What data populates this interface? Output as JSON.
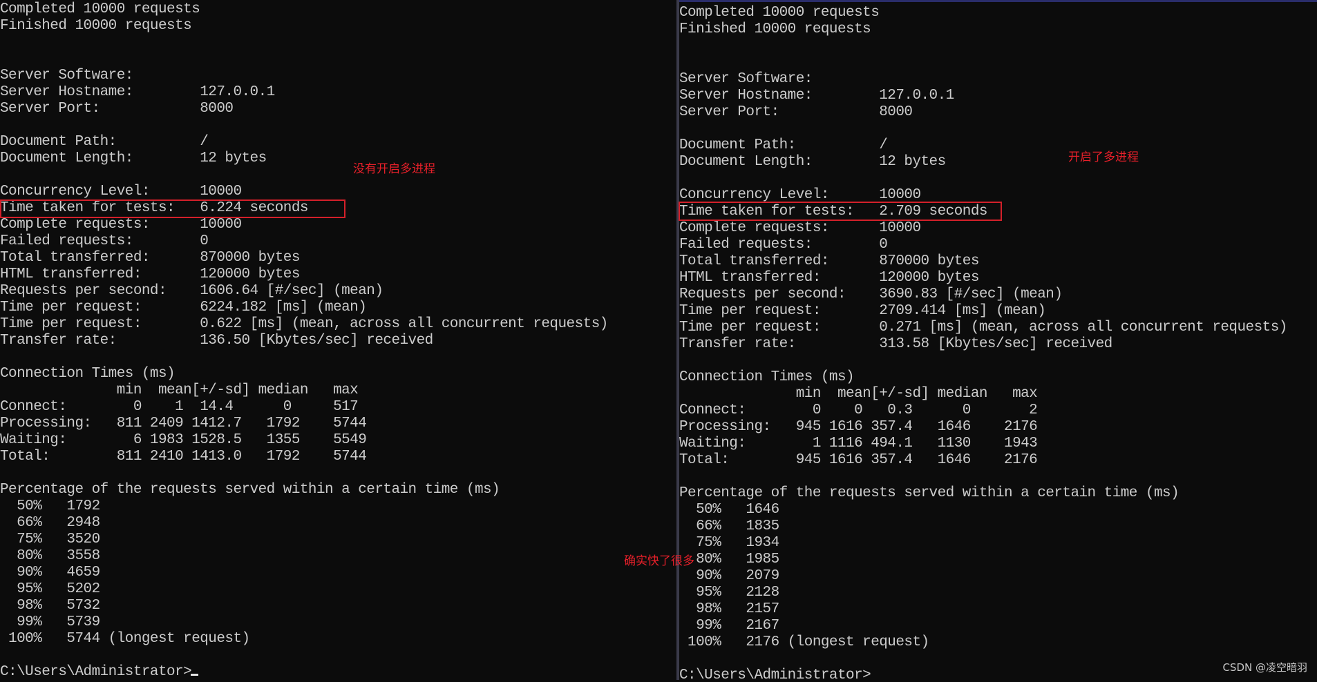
{
  "left": {
    "lines": [
      "Completed 10000 requests",
      "Finished 10000 requests",
      "",
      "",
      "Server Software:",
      "Server Hostname:        127.0.0.1",
      "Server Port:            8000",
      "",
      "Document Path:          /",
      "Document Length:        12 bytes",
      "",
      "Concurrency Level:      10000",
      "Time taken for tests:   6.224 seconds",
      "Complete requests:      10000",
      "Failed requests:        0",
      "Total transferred:      870000 bytes",
      "HTML transferred:       120000 bytes",
      "Requests per second:    1606.64 [#/sec] (mean)",
      "Time per request:       6224.182 [ms] (mean)",
      "Time per request:       0.622 [ms] (mean, across all concurrent requests)",
      "Transfer rate:          136.50 [Kbytes/sec] received",
      "",
      "Connection Times (ms)",
      "              min  mean[+/-sd] median   max",
      "Connect:        0    1  14.4      0     517",
      "Processing:   811 2409 1412.7   1792    5744",
      "Waiting:        6 1983 1528.5   1355    5549",
      "Total:        811 2410 1413.0   1792    5744",
      "",
      "Percentage of the requests served within a certain time (ms)",
      "  50%   1792",
      "  66%   2948",
      "  75%   3520",
      "  80%   3558",
      "  90%   4659",
      "  95%   5202",
      "  98%   5732",
      "  99%   5739",
      " 100%   5744 (longest request)",
      "",
      "C:\\Users\\Administrator>"
    ],
    "annotation": "没有开启多进程"
  },
  "right": {
    "lines": [
      "Completed 10000 requests",
      "Finished 10000 requests",
      "",
      "",
      "Server Software:",
      "Server Hostname:        127.0.0.1",
      "Server Port:            8000",
      "",
      "Document Path:          /",
      "Document Length:        12 bytes",
      "",
      "Concurrency Level:      10000",
      "Time taken for tests:   2.709 seconds",
      "Complete requests:      10000",
      "Failed requests:        0",
      "Total transferred:      870000 bytes",
      "HTML transferred:       120000 bytes",
      "Requests per second:    3690.83 [#/sec] (mean)",
      "Time per request:       2709.414 [ms] (mean)",
      "Time per request:       0.271 [ms] (mean, across all concurrent requests)",
      "Transfer rate:          313.58 [Kbytes/sec] received",
      "",
      "Connection Times (ms)",
      "              min  mean[+/-sd] median   max",
      "Connect:        0    0   0.3      0       2",
      "Processing:   945 1616 357.4   1646    2176",
      "Waiting:        1 1116 494.1   1130    1943",
      "Total:        945 1616 357.4   1646    2176",
      "",
      "Percentage of the requests served within a certain time (ms)",
      "  50%   1646",
      "  66%   1835",
      "  75%   1934",
      "  80%   1985",
      "  90%   2079",
      "  95%   2128",
      "  98%   2157",
      "  99%   2167",
      " 100%   2176 (longest request)",
      "",
      "C:\\Users\\Administrator>"
    ],
    "annotation": "开启了多进程"
  },
  "middle_annotation": "确实快了很多",
  "watermark": "CSDN @凌空暗羽",
  "colors": {
    "background": "#0c0c0c",
    "text": "#cccccc",
    "annotation": "#e8202a",
    "highlight_box": "#d4202a"
  }
}
